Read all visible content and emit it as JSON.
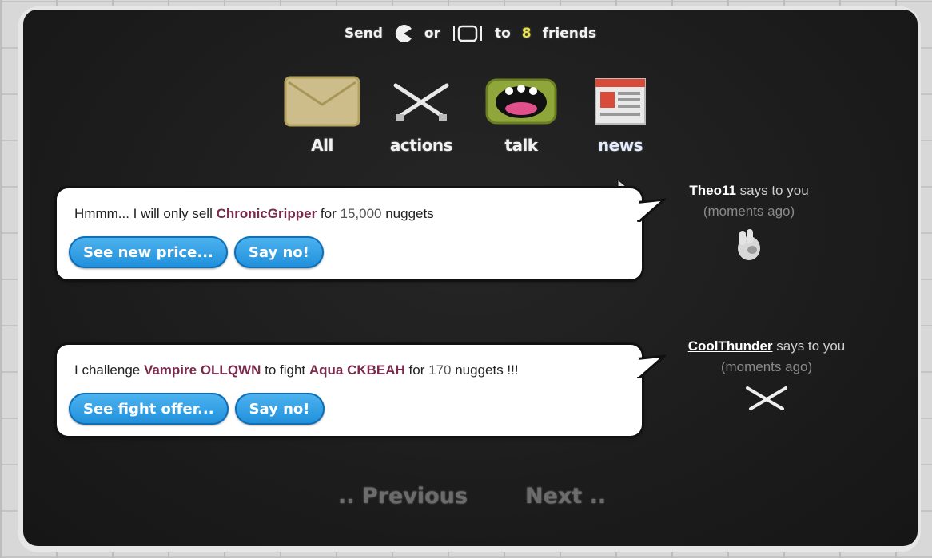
{
  "header": {
    "send_word": "Send",
    "or_word": "or",
    "to_word": "to",
    "friend_count": "8",
    "friends_word": "friends"
  },
  "categories": [
    {
      "label": "All",
      "icon": "envelope-icon"
    },
    {
      "label": "actions",
      "icon": "crossed-swords-icon"
    },
    {
      "label": "talk",
      "icon": "monster-mouth-icon"
    },
    {
      "label": "news",
      "icon": "newspaper-icon"
    }
  ],
  "messages": [
    {
      "text_1": "Hmmm... I will only sell ",
      "item": "ChronicGripper",
      "text_2": " for ",
      "amount": "15,000",
      "text_3": " nuggets",
      "buttons": [
        "See new price...",
        "Say no!"
      ],
      "sender": "Theo11",
      "says": " says to you",
      "when": "(moments ago)",
      "icon": "glove-icon"
    },
    {
      "text_1": "I challenge ",
      "item": "Vampire OLLQWN",
      "text_2": " to fight ",
      "item2": "Aqua CKBEAH",
      "text_3": " for ",
      "amount": "170",
      "text_4": " nuggets !!!",
      "buttons": [
        "See fight offer...",
        "Say no!"
      ],
      "sender": "CoolThunder",
      "says": " says to you",
      "when": "(moments ago)",
      "icon": "crossed-swords-icon"
    }
  ],
  "pager": {
    "previous": ".. Previous",
    "next": "Next .."
  },
  "colors": {
    "board": "#1c1c1c",
    "button_blue": "#1e8fdb",
    "highlight": "#7a2a4a",
    "count_yellow": "#e8e24a"
  }
}
